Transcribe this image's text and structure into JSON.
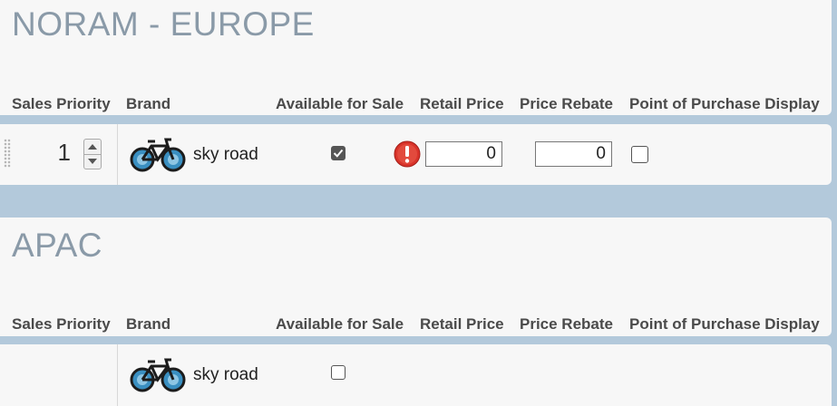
{
  "sections": [
    {
      "title": "NORAM - EUROPE",
      "columns": {
        "sales_priority": "Sales Priority",
        "brand": "Brand",
        "available": "Available for Sale",
        "retail_price": "Retail Price",
        "price_rebate": "Price Rebate",
        "pop_display": "Point of Purchase Display"
      },
      "row": {
        "priority": "1",
        "brand": "sky road",
        "available_checked": true,
        "has_warning": true,
        "retail_price": "0",
        "price_rebate": "0",
        "pop_display_checked": false
      }
    },
    {
      "title": "APAC",
      "columns": {
        "sales_priority": "Sales Priority",
        "brand": "Brand",
        "available": "Available for Sale",
        "retail_price": "Retail Price",
        "price_rebate": "Price Rebate",
        "pop_display": "Point of Purchase Display"
      },
      "row": {
        "brand": "sky road",
        "available_checked": false
      }
    }
  ],
  "icons": {
    "bike": "bicycle-icon",
    "warning": "exclamation-circle-icon",
    "drag": "drag-handle-icon"
  },
  "colors": {
    "background": "#b3c9db",
    "panel": "#f7f7f7",
    "title": "#8a9aa8",
    "warning": "#d9342b"
  }
}
